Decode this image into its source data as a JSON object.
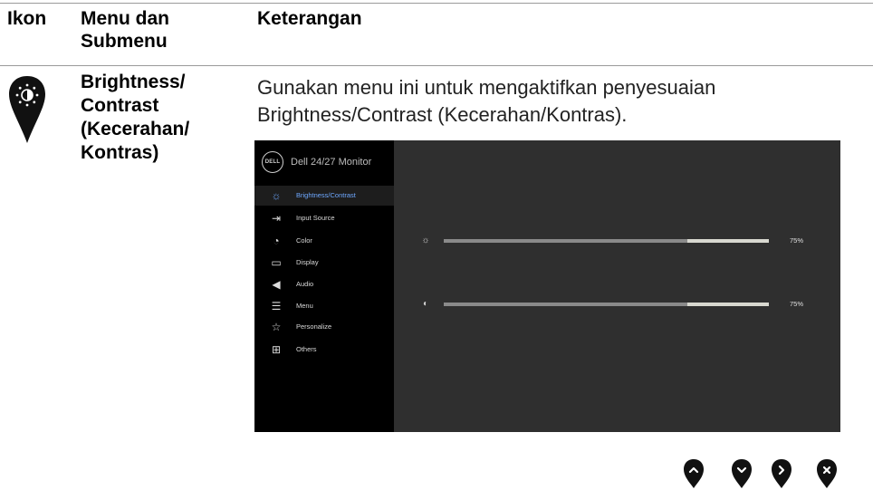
{
  "header": {
    "col_icon": "Ikon",
    "col_menu": "Menu dan Submenu",
    "col_desc": "Keterangan"
  },
  "row": {
    "icon": "brightness-contrast-pin-icon",
    "submenu": "Brightness/ Contrast (Kecerahan/ Kontras)",
    "description": "Gunakan menu ini untuk mengaktifkan penyesuaian Brightness/Contrast (Kecerahan/Kontras)."
  },
  "osd": {
    "logo": "DELL",
    "title": "Dell 24/27 Monitor",
    "accent_color": "#6ea8ff",
    "menu_items": [
      {
        "label": "Brightness/Contrast",
        "icon": "brightness-icon",
        "active": true
      },
      {
        "label": "Input Source",
        "icon": "input-source-icon",
        "active": false
      },
      {
        "label": "Color",
        "icon": "color-palette-icon",
        "active": false
      },
      {
        "label": "Display",
        "icon": "display-icon",
        "active": false
      },
      {
        "label": "Audio",
        "icon": "speaker-icon",
        "active": false
      },
      {
        "label": "Menu",
        "icon": "menu-icon",
        "active": false
      },
      {
        "label": "Personalize",
        "icon": "star-icon",
        "active": false
      },
      {
        "label": "Others",
        "icon": "others-icon",
        "active": false
      }
    ],
    "sliders": [
      {
        "name": "brightness",
        "icon": "sun-icon",
        "value_pct": 75,
        "value_text": "75%"
      },
      {
        "name": "contrast",
        "icon": "contrast-icon",
        "value_pct": 75,
        "value_text": "75%"
      }
    ]
  },
  "nav_buttons": [
    {
      "icon": "chevron-up-icon"
    },
    {
      "icon": "chevron-down-icon"
    },
    {
      "icon": "chevron-right-icon"
    },
    {
      "icon": "close-icon"
    }
  ]
}
